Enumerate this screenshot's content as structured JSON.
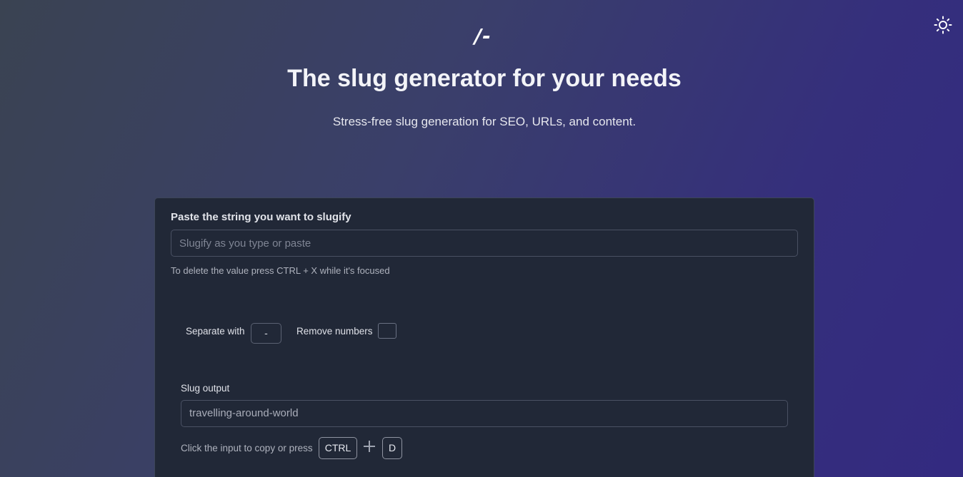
{
  "header": {
    "logo": "/-",
    "title": "The slug generator for your needs",
    "subtitle": "Stress-free slug generation for SEO, URLs, and content."
  },
  "theme_toggle": {
    "icon": "sun-icon"
  },
  "form": {
    "input_label": "Paste the string you want to slugify",
    "input_placeholder": "Slugify as you type or paste",
    "input_value": "",
    "delete_hint": "To delete the value press CTRL + X while it's focused",
    "separator_label": "Separate with",
    "separator_value": "-",
    "remove_numbers_label": "Remove numbers",
    "remove_numbers_checked": false
  },
  "output": {
    "label": "Slug output",
    "value": "travelling-around-world",
    "copy_hint": "Click the input to copy or press",
    "key_ctrl": "CTRL",
    "key_d": "D"
  }
}
